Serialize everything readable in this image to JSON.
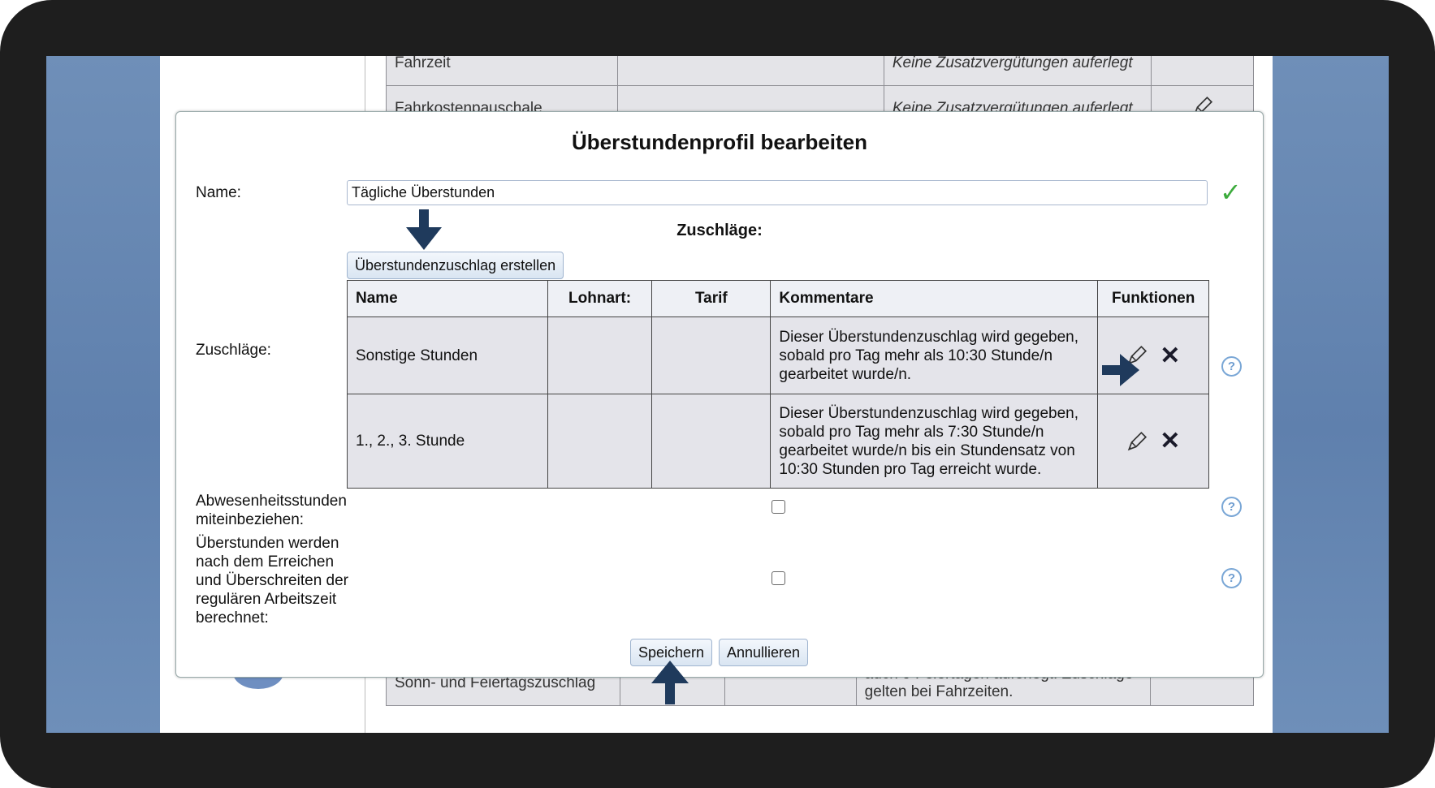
{
  "background": {
    "rows_top": [
      {
        "name": "Fahrzeit",
        "comment": "Keine Zusatzvergütungen auferlegt"
      },
      {
        "name": "Fahrkostenpauschale",
        "comment": "Keine Zusatzvergütungen auferlegt"
      }
    ],
    "row_bottom": {
      "name": "Sonn- und Feiertagszuschlag",
      "comment": "auch 9 Feiertagen auferlegt. Zuschläge gelten bei Fahrzeiten."
    }
  },
  "dialog": {
    "title": "Überstundenprofil bearbeiten",
    "name_label": "Name:",
    "name_value": "Tägliche Überstunden",
    "zuschlaege_heading": "Zuschläge:",
    "zuschlaege_label": "Zuschläge:",
    "create_button": "Überstundenzuschlag erstellen",
    "table": {
      "headers": [
        "Name",
        "Lohnart:",
        "Tarif",
        "Kommentare",
        "Funktionen"
      ],
      "rows": [
        {
          "name": "Sonstige Stunden",
          "lohnart": "",
          "tarif": "",
          "kommentar": "Dieser Überstundenzuschlag wird gegeben, sobald pro Tag mehr als 10:30 Stunde/n gearbeitet wurde/n."
        },
        {
          "name": "1., 2., 3. Stunde",
          "lohnart": "",
          "tarif": "",
          "kommentar": "Dieser Überstundenzuschlag wird gegeben, sobald pro Tag mehr als 7:30 Stunde/n gearbeitet wurde/n bis ein Stundensatz von 10:30 Stunden pro Tag erreicht wurde."
        }
      ]
    },
    "absence_label": "Abwesenheitsstunden miteinbeziehen:",
    "overtime_label": "Überstunden werden nach dem Erreichen und Überschreiten der regulären Arbeitszeit berechnet:",
    "absence_checked": false,
    "overtime_checked": false,
    "help_glyph": "?",
    "save_button": "Speichern",
    "cancel_button": "Annullieren",
    "check_glyph": "✓",
    "delete_glyph": "✕"
  },
  "colors": {
    "arrow": "#1f3a5c",
    "accent_check": "#3cab3c",
    "help": "#7aa7d6"
  },
  "icons": {
    "edit": "pencil-icon",
    "delete": "close-icon",
    "help": "help-circle-icon",
    "valid": "checkmark-icon",
    "annotation": "arrow-icon"
  }
}
